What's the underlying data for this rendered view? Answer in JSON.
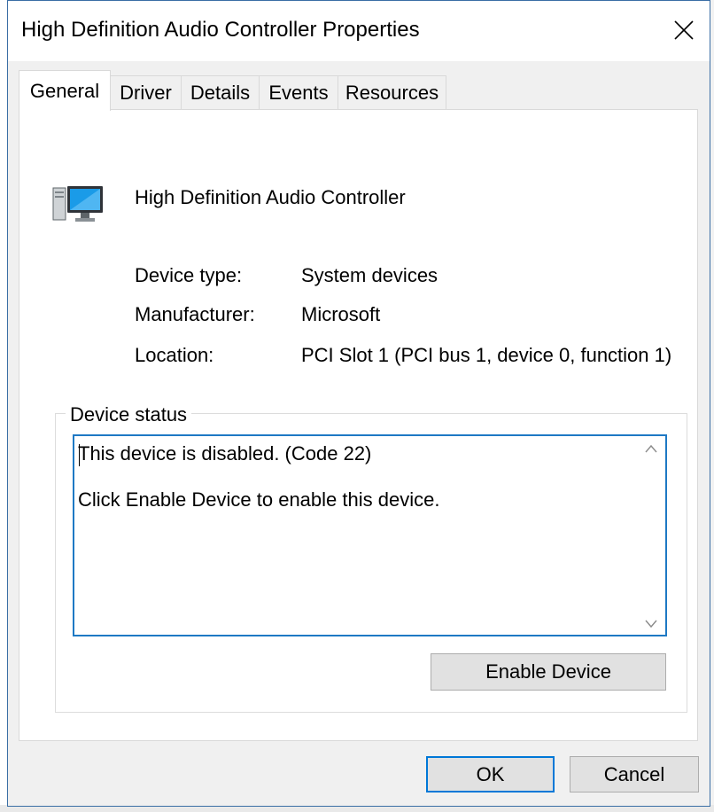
{
  "window": {
    "title": "High Definition Audio Controller Properties",
    "close_label": "×"
  },
  "tabs": [
    {
      "label": "General",
      "active": true
    },
    {
      "label": "Driver",
      "active": false
    },
    {
      "label": "Details",
      "active": false
    },
    {
      "label": "Events",
      "active": false
    },
    {
      "label": "Resources",
      "active": false
    }
  ],
  "device": {
    "name": "High Definition Audio Controller",
    "icon": "computer-monitor-icon"
  },
  "properties": [
    {
      "label": "Device type:",
      "value": "System devices"
    },
    {
      "label": "Manufacturer:",
      "value": "Microsoft"
    },
    {
      "label": "Location:",
      "value": "PCI Slot 1 (PCI bus 1, device 0, function 1)"
    }
  ],
  "status": {
    "caption": "Device status",
    "line1": "This device is disabled. (Code 22)",
    "line2": "Click Enable Device to enable this device."
  },
  "buttons": {
    "enable_device": "Enable Device",
    "ok": "OK",
    "cancel": "Cancel"
  },
  "colors": {
    "accent": "#0078d7",
    "client_bg": "#f0f0f0",
    "panel_bg": "#ffffff"
  }
}
